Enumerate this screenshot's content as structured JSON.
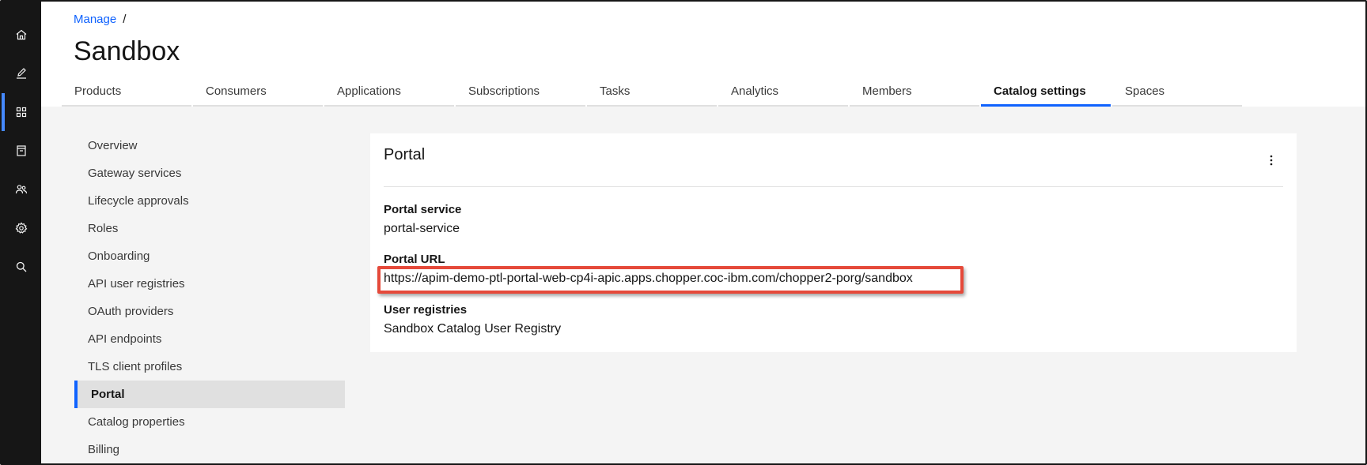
{
  "breadcrumb": {
    "parent": "Manage",
    "separator": "/"
  },
  "page": {
    "title": "Sandbox"
  },
  "tabs": [
    {
      "label": "Products"
    },
    {
      "label": "Consumers"
    },
    {
      "label": "Applications"
    },
    {
      "label": "Subscriptions"
    },
    {
      "label": "Tasks"
    },
    {
      "label": "Analytics"
    },
    {
      "label": "Members"
    },
    {
      "label": "Catalog settings",
      "active": true
    },
    {
      "label": "Spaces"
    }
  ],
  "rail": {
    "icons": [
      "home-icon",
      "edit-icon",
      "dashboard-icon",
      "catalog-icon",
      "users-icon",
      "settings-icon",
      "search-icon"
    ],
    "active": "dashboard-icon"
  },
  "sidenav": [
    {
      "label": "Overview"
    },
    {
      "label": "Gateway services"
    },
    {
      "label": "Lifecycle approvals"
    },
    {
      "label": "Roles"
    },
    {
      "label": "Onboarding"
    },
    {
      "label": "API user registries"
    },
    {
      "label": "OAuth providers"
    },
    {
      "label": "API endpoints"
    },
    {
      "label": "TLS client profiles"
    },
    {
      "label": "Portal",
      "active": true
    },
    {
      "label": "Catalog properties"
    },
    {
      "label": "Billing"
    }
  ],
  "card": {
    "title": "Portal",
    "portal_service_label": "Portal service",
    "portal_service_value": "portal-service",
    "portal_url_label": "Portal URL",
    "portal_url_value": "https://apim-demo-ptl-portal-web-cp4i-apic.apps.chopper.coc-ibm.com/chopper2-porg/sandbox",
    "user_registries_label": "User registries",
    "user_registries_value": "Sandbox Catalog User Registry"
  },
  "colors": {
    "accent": "#0f62fe",
    "rail_bg": "#161616",
    "highlight_box": "#e5493a",
    "content_bg": "#f4f4f4"
  }
}
